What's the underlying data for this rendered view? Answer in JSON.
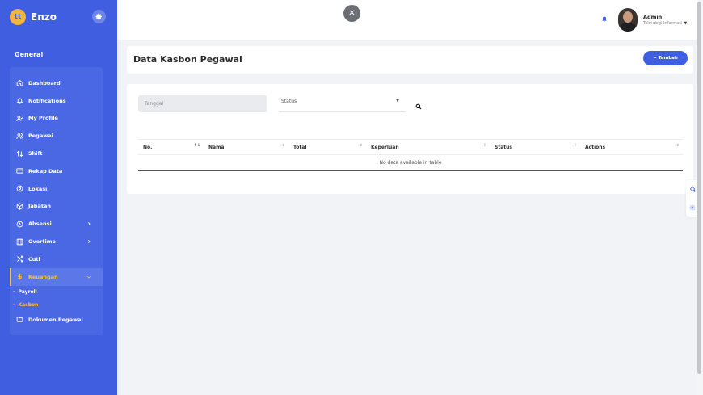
{
  "brand": {
    "name": "Enzo",
    "logo_text": "tt"
  },
  "sidebar": {
    "section_title": "General",
    "items": [
      {
        "label": "Dashboard",
        "icon": "home-icon"
      },
      {
        "label": "Notifications",
        "icon": "bell-icon"
      },
      {
        "label": "My Profile",
        "icon": "user-check-icon"
      },
      {
        "label": "Pegawai",
        "icon": "users-icon"
      },
      {
        "label": "Shift",
        "icon": "swap-arrows-icon"
      },
      {
        "label": "Rekap Data",
        "icon": "credit-card-icon"
      },
      {
        "label": "Lokasi",
        "icon": "location-icon"
      },
      {
        "label": "Jabatan",
        "icon": "box-icon"
      },
      {
        "label": "Absensi",
        "icon": "clock-icon"
      },
      {
        "label": "Overtime",
        "icon": "film-icon"
      },
      {
        "label": "Cuti",
        "icon": "shuffle-icon"
      },
      {
        "label": "Keuangan",
        "icon": "dollar-icon"
      }
    ],
    "submenu": [
      {
        "label": "Payroll"
      },
      {
        "label": "Kasbon"
      }
    ],
    "last_item": {
      "label": "Dokumen Pegawai",
      "icon": "folder-icon"
    }
  },
  "topbar": {
    "user_name": "Admin",
    "user_role": "Teknologi Informasi"
  },
  "page": {
    "title": "Data Kasbon Pegawai",
    "add_button": "+ Tambah"
  },
  "filters": {
    "date_placeholder": "Tanggal",
    "status_label": "Status"
  },
  "table": {
    "columns": [
      "No.",
      "Nama",
      "Total",
      "Keperluan",
      "Status",
      "Actions"
    ],
    "empty_message": "No data available in table"
  },
  "colors": {
    "sidebar": "#3f5ee0",
    "accent": "#f4c23c",
    "primary_button": "#3f5ee0"
  }
}
